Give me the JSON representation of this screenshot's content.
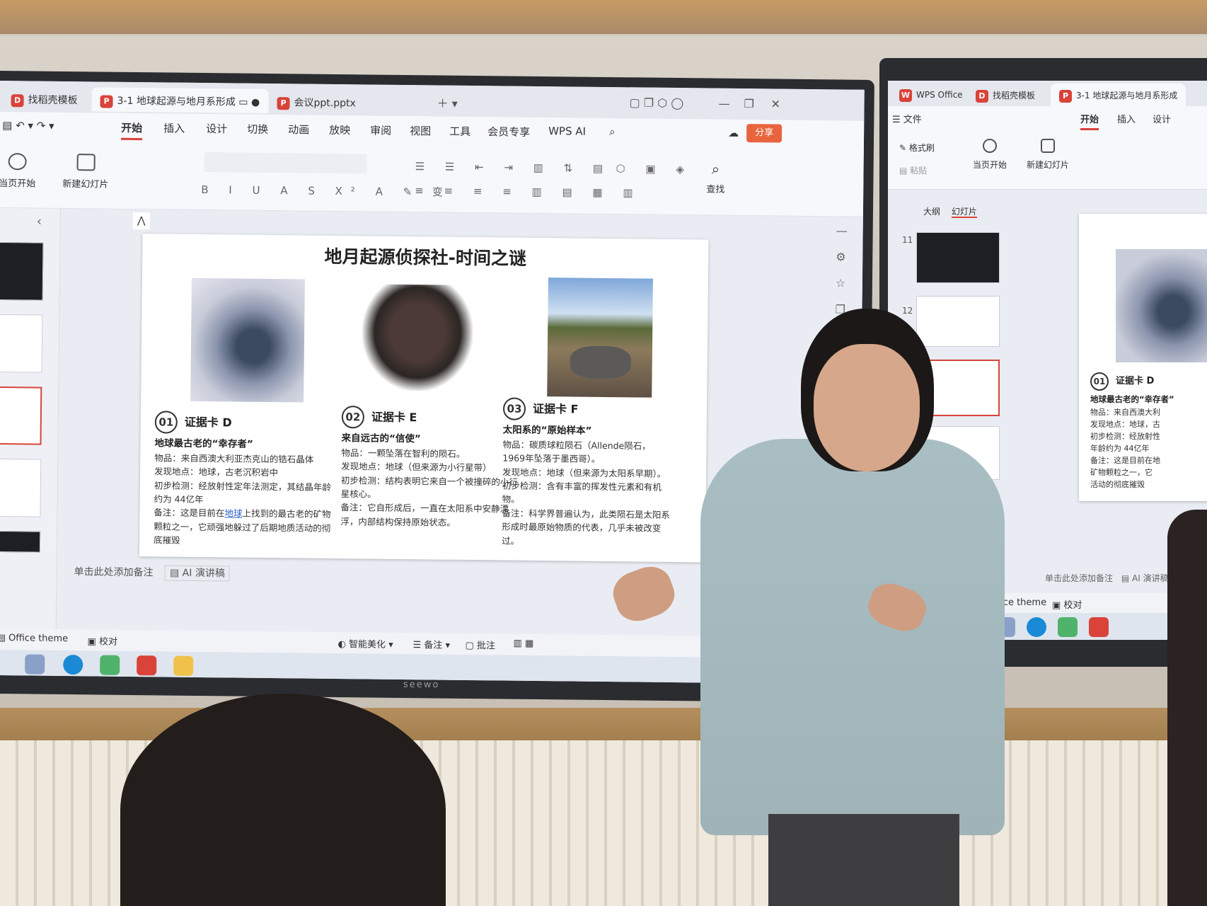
{
  "colors": {
    "accent": "#d9433a",
    "share": "#e9643e",
    "link": "#2a62c8"
  },
  "main_window": {
    "tabs": [
      {
        "label": "找稻壳模板"
      },
      {
        "label": "3-1 地球起源与地月系形成"
      },
      {
        "label": "会议ppt.pptx"
      }
    ],
    "menu": [
      "开始",
      "插入",
      "设计",
      "切换",
      "动画",
      "放映",
      "审阅",
      "视图",
      "工具",
      "会员专享",
      "WPS AI"
    ],
    "share_label": "分享",
    "ribbon": {
      "from_current": "当页开始",
      "new_slide": "新建幻灯片",
      "find": "查找"
    },
    "slide": {
      "title": "地月起源侦探社-时间之谜",
      "cards": [
        {
          "num": "01",
          "title": "证据卡 D",
          "subtitle": "地球最古老的“幸存者”",
          "lines": [
            "物品：来自西澳大利亚杰克山的锆石晶体",
            "发现地点：地球，古老沉积岩中",
            "初步检测：经放射性定年法测定，其结晶年龄约为 44亿年",
            "备注：这是目前在",
            "地球",
            "上找到的最古老的矿物颗粒之一，它顽强地躲过了后期地质活动的彻底摧毁"
          ]
        },
        {
          "num": "02",
          "title": "证据卡 E",
          "subtitle": "来自远古的“信使”",
          "lines": [
            "物品：一颗坠落在智利的陨石。",
            "发现地点：地球（但来源为小行星带）",
            "初步检测：结构表明它来自一个被撞碎的小行星核心。",
            "备注：它自形成后，一直在太阳系中安静漂浮，内部结构保持原始状态。"
          ]
        },
        {
          "num": "03",
          "title": "证据卡 F",
          "subtitle": "太阳系的“原始样本”",
          "lines": [
            "物品：碳质球粒陨石（Allende陨石，1969年坠落于墨西哥）。",
            "发现地点：地球（但来源为太阳系早期）。",
            "初步检测：含有丰富的挥发性元素和有机物。",
            "备注：科学界普遍认为，此类陨石是太阳系形成时最原始物质的代表，几乎未被改变过。"
          ]
        }
      ]
    },
    "notes_placeholder": "单击此处添加备注",
    "ai_notes": "AI 演讲稿",
    "status": {
      "theme": "Office theme",
      "proof": "校对",
      "beautify": "智能美化",
      "remarks": "备注",
      "comment": "批注"
    }
  },
  "second_window": {
    "tabs": [
      {
        "label": "WPS Office"
      },
      {
        "label": "找稻壳模板"
      },
      {
        "label": "3-1 地球起源与地月系形成"
      }
    ],
    "menu": [
      "文件",
      "开始",
      "插入",
      "设计"
    ],
    "ribbon": {
      "format_painter": "格式刷",
      "paste": "粘贴",
      "from_current": "当页开始",
      "new_slide": "新建幻灯片"
    },
    "panel_tabs": [
      "大纲",
      "幻灯片"
    ],
    "slide_numbers": [
      "11",
      "12"
    ],
    "card": {
      "num": "01",
      "title": "证据卡 D",
      "subtitle": "地球最古老的“幸存者”",
      "lines": [
        "物品：来自西澳大利",
        "发现地点：地球，古",
        "初步检测：经放射性",
        "年龄约为 44亿年",
        "备注：这是目前在地",
        "矿物颗粒之一，它",
        "活动的彻底摧毁"
      ]
    },
    "notes_placeholder": "单击此处添加备注",
    "ai_notes": "AI 演讲稿",
    "status": {
      "theme": "Office theme",
      "proof": "校对"
    }
  },
  "board_brand": "seewo"
}
